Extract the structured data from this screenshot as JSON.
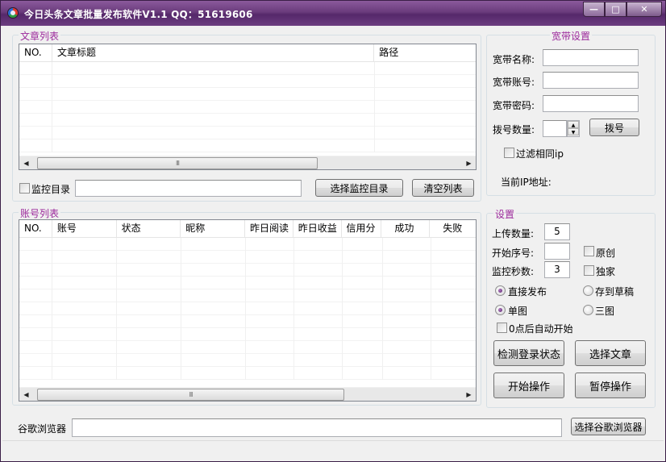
{
  "window": {
    "title": "今日头条文章批量发布软件V1.1 QQ：51619606",
    "minimize": "—",
    "maximize": "□",
    "close": "✕"
  },
  "articles": {
    "group_title": "文章列表",
    "columns": [
      "NO.",
      "文章标题",
      "路径"
    ],
    "scroll_grip": "III",
    "monitor_label": "监控目录",
    "monitor_value": "",
    "select_dir_button": "选择监控目录",
    "clear_button": "清空列表"
  },
  "accounts": {
    "group_title": "账号列表",
    "columns": [
      "NO.",
      "账号",
      "状态",
      "昵称",
      "昨日阅读",
      "昨日收益",
      "信用分",
      "成功",
      "失败"
    ],
    "scroll_grip": "III"
  },
  "broadband": {
    "group_title": "宽带设置",
    "name_label": "宽带名称:",
    "name_value": "",
    "account_label": "宽带账号:",
    "account_value": "",
    "password_label": "宽带密码:",
    "password_value": "",
    "dial_count_label": "拨号数量:",
    "dial_count_value": "",
    "dial_button": "拨号",
    "filter_ip_label": "过滤相同ip",
    "current_ip_label": "当前IP地址:"
  },
  "settings": {
    "group_title": "设置",
    "upload_count_label": "上传数量:",
    "upload_count_value": "5",
    "start_no_label": "开始序号:",
    "start_no_value": "",
    "original_label": "原创",
    "monitor_seconds_label": "监控秒数:",
    "monitor_seconds_value": "3",
    "exclusive_label": "独家",
    "publish_direct_label": "直接发布",
    "save_draft_label": "存到草稿",
    "single_image_label": "单图",
    "three_image_label": "三图",
    "auto_start_label": "0点后自动开始",
    "check_login_button": "检测登录状态",
    "select_article_button": "选择文章",
    "start_button": "开始操作",
    "pause_button": "暂停操作"
  },
  "browser": {
    "label": "谷歌浏览器",
    "path_value": "",
    "select_button": "选择谷歌浏览器"
  },
  "icons": {
    "app": "app-icon",
    "scroll_left": "◀",
    "scroll_right": "▶",
    "spin_up": "▲",
    "spin_down": "▼"
  }
}
